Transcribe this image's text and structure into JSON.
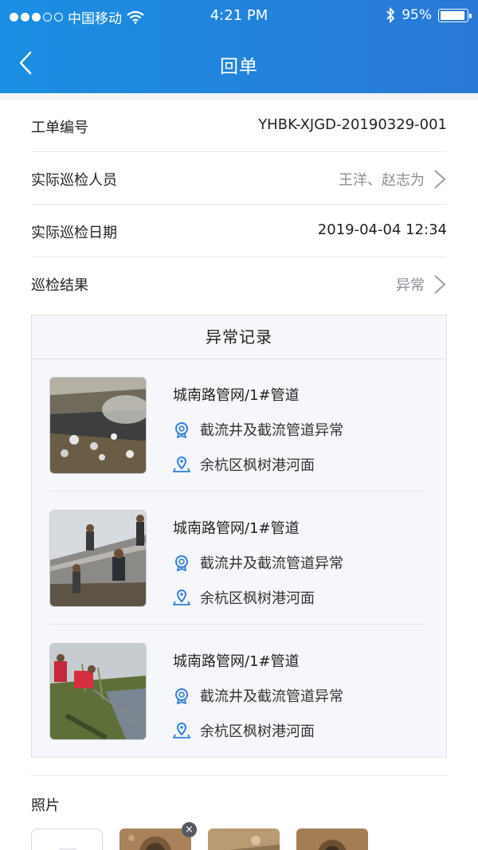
{
  "status_bar": {
    "carrier": "中国移动",
    "time": "4:21 PM",
    "battery": "95%",
    "battery_level": 0.95
  },
  "nav": {
    "title": "回单"
  },
  "fields": {
    "order_no_label": "工单编号",
    "order_no_value": "YHBK-XJGD-20190329-001",
    "inspector_label": "实际巡检人员",
    "inspector_value": "王洋、赵志为",
    "date_label": "实际巡检日期",
    "date_value": "2019-04-04 12:34",
    "result_label": "巡检结果",
    "result_value": "异常"
  },
  "abnormal": {
    "title": "异常记录",
    "records": [
      {
        "title": "城南路管网/1#管道",
        "issue": "截流井及截流管道异常",
        "location": "余杭区枫树港河面"
      },
      {
        "title": "城南路管网/1#管道",
        "issue": "截流井及截流管道异常",
        "location": "余杭区枫树港河面"
      },
      {
        "title": "城南路管网/1#管道",
        "issue": "截流井及截流管道异常",
        "location": "余杭区枫树港河面"
      }
    ]
  },
  "photos": {
    "label": "照片",
    "delete_glyph": "×"
  },
  "colors": {
    "header_start": "#1a8fe3",
    "header_end": "#2a78d6",
    "icon_blue": "#2f7fe0"
  }
}
